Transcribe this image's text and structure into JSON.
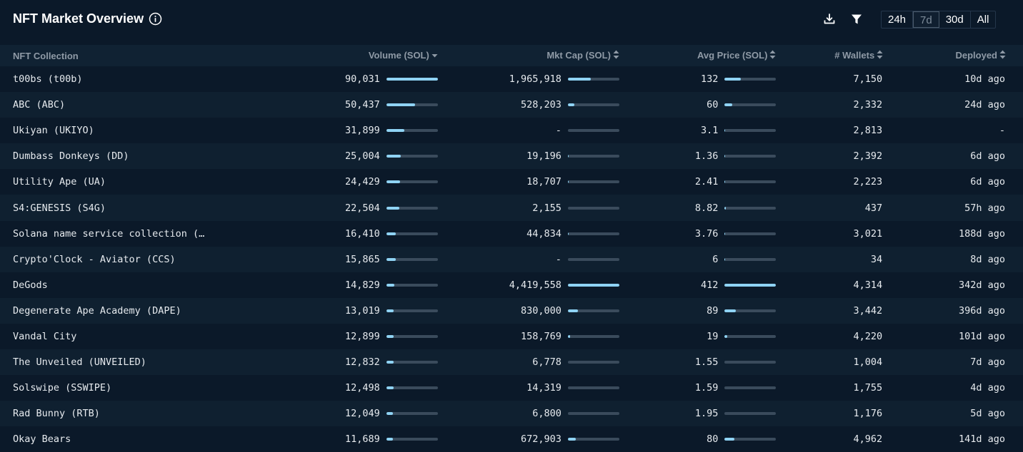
{
  "header": {
    "title": "NFT Market Overview",
    "time_ranges": [
      "24h",
      "7d",
      "30d",
      "All"
    ],
    "selected_range": "7d"
  },
  "icons": {
    "info": "info-icon",
    "download": "download-icon",
    "filter": "filter-icon",
    "sort_desc": "sort-descending-icon",
    "sort": "sort-icon"
  },
  "colors": {
    "background": "#0b1929",
    "header_row": "#102233",
    "bar_fill": "#8fd3f4",
    "bar_track": "#3a4b5c"
  },
  "table": {
    "columns": [
      {
        "label": "NFT Collection"
      },
      {
        "label": "Volume (SOL)",
        "sort": "desc"
      },
      {
        "label": "Mkt Cap (SOL)",
        "sort": "both"
      },
      {
        "label": "Avg Price (SOL)",
        "sort": "both"
      },
      {
        "label": "# Wallets",
        "sort": "both"
      },
      {
        "label": "Deployed",
        "sort": "both"
      }
    ],
    "rows": [
      {
        "name": "t00bs (t00b)",
        "volume": "90,031",
        "volume_pct": 100,
        "mktcap": "1,965,918",
        "mktcap_pct": 44,
        "avg_price": "132",
        "avg_price_pct": 32,
        "wallets": "7,150",
        "deployed": "10d ago"
      },
      {
        "name": "ABC (ABC)",
        "volume": "50,437",
        "volume_pct": 56,
        "mktcap": "528,203",
        "mktcap_pct": 12,
        "avg_price": "60",
        "avg_price_pct": 15,
        "wallets": "2,332",
        "deployed": "24d ago"
      },
      {
        "name": "Ukiyan (UKIYO)",
        "volume": "31,899",
        "volume_pct": 35,
        "mktcap": "-",
        "mktcap_pct": 0,
        "avg_price": "3.1",
        "avg_price_pct": 1,
        "wallets": "2,813",
        "deployed": "-"
      },
      {
        "name": "Dumbass Donkeys (DD)",
        "volume": "25,004",
        "volume_pct": 28,
        "mktcap": "19,196",
        "mktcap_pct": 1,
        "avg_price": "1.36",
        "avg_price_pct": 1,
        "wallets": "2,392",
        "deployed": "6d ago"
      },
      {
        "name": "Utility Ape (UA)",
        "volume": "24,429",
        "volume_pct": 27,
        "mktcap": "18,707",
        "mktcap_pct": 1,
        "avg_price": "2.41",
        "avg_price_pct": 1,
        "wallets": "2,223",
        "deployed": "6d ago"
      },
      {
        "name": "S4:GENESIS (S4G)",
        "volume": "22,504",
        "volume_pct": 25,
        "mktcap": "2,155",
        "mktcap_pct": 0,
        "avg_price": "8.82",
        "avg_price_pct": 2,
        "wallets": "437",
        "deployed": "57h ago"
      },
      {
        "name": "Solana name service collection (…",
        "volume": "16,410",
        "volume_pct": 18,
        "mktcap": "44,834",
        "mktcap_pct": 1,
        "avg_price": "3.76",
        "avg_price_pct": 1,
        "wallets": "3,021",
        "deployed": "188d ago"
      },
      {
        "name": "Crypto'Clock - Aviator (CCS)",
        "volume": "15,865",
        "volume_pct": 18,
        "mktcap": "-",
        "mktcap_pct": 0,
        "avg_price": "6",
        "avg_price_pct": 1,
        "wallets": "34",
        "deployed": "8d ago"
      },
      {
        "name": "DeGods",
        "volume": "14,829",
        "volume_pct": 16,
        "mktcap": "4,419,558",
        "mktcap_pct": 100,
        "avg_price": "412",
        "avg_price_pct": 100,
        "wallets": "4,314",
        "deployed": "342d ago"
      },
      {
        "name": "Degenerate Ape Academy (DAPE)",
        "volume": "13,019",
        "volume_pct": 14,
        "mktcap": "830,000",
        "mktcap_pct": 19,
        "avg_price": "89",
        "avg_price_pct": 22,
        "wallets": "3,442",
        "deployed": "396d ago"
      },
      {
        "name": "Vandal City",
        "volume": "12,899",
        "volume_pct": 14,
        "mktcap": "158,769",
        "mktcap_pct": 4,
        "avg_price": "19",
        "avg_price_pct": 5,
        "wallets": "4,220",
        "deployed": "101d ago"
      },
      {
        "name": "The Unveiled (UNVEILED)",
        "volume": "12,832",
        "volume_pct": 14,
        "mktcap": "6,778",
        "mktcap_pct": 0,
        "avg_price": "1.55",
        "avg_price_pct": 0,
        "wallets": "1,004",
        "deployed": "7d ago"
      },
      {
        "name": "Solswipe (SSWIPE)",
        "volume": "12,498",
        "volume_pct": 14,
        "mktcap": "14,319",
        "mktcap_pct": 0,
        "avg_price": "1.59",
        "avg_price_pct": 0,
        "wallets": "1,755",
        "deployed": "4d ago"
      },
      {
        "name": "Rad Bunny (RTB)",
        "volume": "12,049",
        "volume_pct": 13,
        "mktcap": "6,800",
        "mktcap_pct": 0,
        "avg_price": "1.95",
        "avg_price_pct": 0,
        "wallets": "1,176",
        "deployed": "5d ago"
      },
      {
        "name": "Okay Bears",
        "volume": "11,689",
        "volume_pct": 13,
        "mktcap": "672,903",
        "mktcap_pct": 15,
        "avg_price": "80",
        "avg_price_pct": 19,
        "wallets": "4,962",
        "deployed": "141d ago"
      }
    ]
  }
}
